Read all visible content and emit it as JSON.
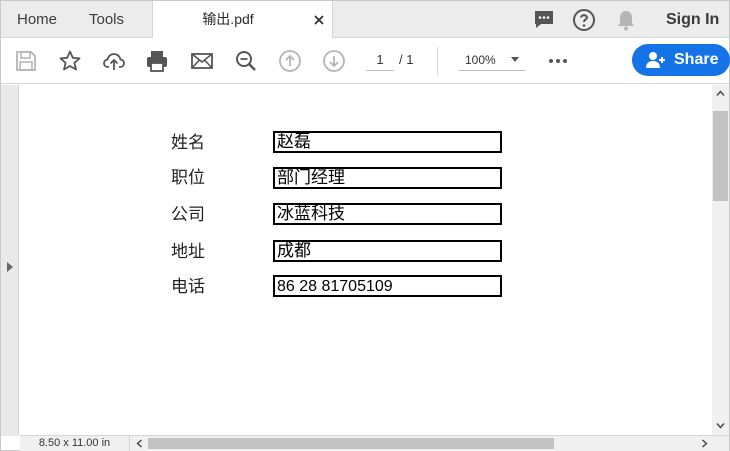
{
  "tabbar": {
    "home_label": "Home",
    "tools_label": "Tools",
    "document_tab": {
      "title": "输出.pdf"
    },
    "sign_in_label": "Sign In"
  },
  "toolbar": {
    "current_page": "1",
    "total_pages": "/ 1",
    "zoom": "100%",
    "share_label": "Share"
  },
  "form": {
    "rows": [
      {
        "label": "姓名",
        "value": "赵磊"
      },
      {
        "label": "职位",
        "value": "部门经理"
      },
      {
        "label": "公司",
        "value": "冰蓝科技"
      },
      {
        "label": "地址",
        "value": "成都"
      },
      {
        "label": "电话",
        "value": "86 28 81705109"
      }
    ]
  },
  "statusbar": {
    "page_size": "8.50 x 11.00 in"
  },
  "colors": {
    "accent": "#1473e6",
    "tabbar_bg": "#ececec",
    "icon_gray": "#555555",
    "disabled_gray": "#b5b5b5"
  },
  "icons": [
    "close-icon",
    "comment-icon",
    "help-icon",
    "bell-icon",
    "save-icon",
    "star-icon",
    "upload-icon",
    "print-icon",
    "mail-icon",
    "zoom-search-icon",
    "page-up-icon",
    "page-down-icon",
    "more-icon",
    "add-user-icon",
    "chevron-down-icon"
  ]
}
